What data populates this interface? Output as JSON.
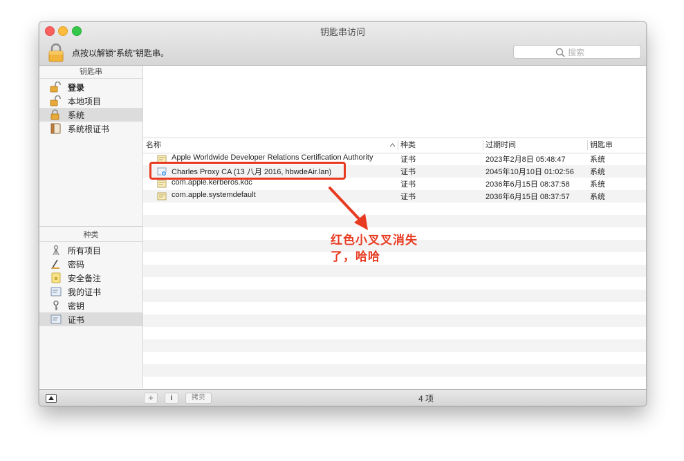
{
  "window": {
    "title": "钥匙串访问"
  },
  "toolbar": {
    "lock_message": "点按以解锁“系统”钥匙串。",
    "search_placeholder": "搜索"
  },
  "sidebar": {
    "keychains_header": "钥匙串",
    "keychains": [
      {
        "label": "登录",
        "icon": "unlocked-padlock-icon",
        "bold": true,
        "selected": false
      },
      {
        "label": "本地项目",
        "icon": "unlocked-padlock-icon",
        "bold": false,
        "selected": false
      },
      {
        "label": "系统",
        "icon": "locked-padlock-icon",
        "bold": false,
        "selected": true
      },
      {
        "label": "系统根证书",
        "icon": "cabinet-icon",
        "bold": false,
        "selected": false
      }
    ],
    "category_header": "种类",
    "categories": [
      {
        "label": "所有项目",
        "icon": "all-items-icon",
        "selected": false
      },
      {
        "label": "密码",
        "icon": "password-icon",
        "selected": false
      },
      {
        "label": "安全备注",
        "icon": "secure-note-icon",
        "selected": false
      },
      {
        "label": "我的证书",
        "icon": "my-certificate-icon",
        "selected": false
      },
      {
        "label": "密钥",
        "icon": "key-icon",
        "selected": false
      },
      {
        "label": "证书",
        "icon": "certificate-icon",
        "selected": true
      }
    ]
  },
  "table": {
    "columns": [
      "名称",
      "种类",
      "过期时间",
      "钥匙串"
    ],
    "rows": [
      {
        "name": "Apple Worldwide Developer Relations Certification Authority",
        "kind": "证书",
        "expires": "2023年2月8日 05:48:47",
        "keychain": "系统"
      },
      {
        "name": "Charles Proxy CA (13 八月 2016, hbwdeAir.lan)",
        "kind": "证书",
        "expires": "2045年10月10日 01:02:56",
        "keychain": "系统"
      },
      {
        "name": "com.apple.kerberos.kdc",
        "kind": "证书",
        "expires": "2036年6月15日 08:37:58",
        "keychain": "系统"
      },
      {
        "name": "com.apple.systemdefault",
        "kind": "证书",
        "expires": "2036年6月15日 08:37:57",
        "keychain": "系统"
      }
    ]
  },
  "footer": {
    "add_label": "+",
    "info_label": "i",
    "copy_label": "拷贝",
    "item_count": "4 项"
  },
  "annotation": {
    "line1": "红色小叉叉消失",
    "line2": "了，哈哈",
    "color": "#e83a21"
  }
}
